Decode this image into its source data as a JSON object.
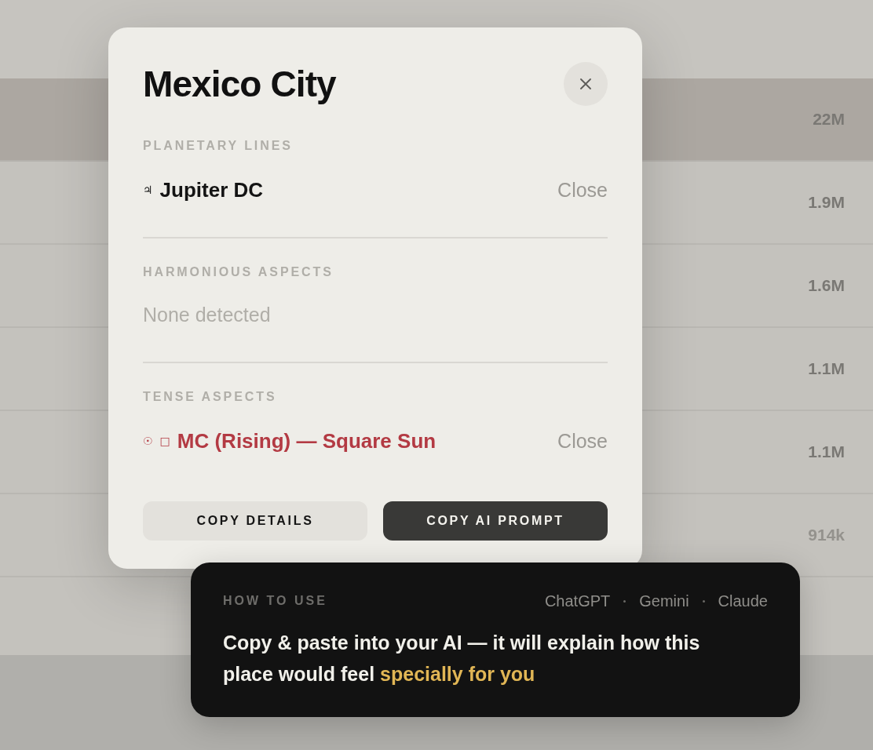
{
  "list": {
    "rows": [
      {
        "value": "22M",
        "selected": true,
        "dimmed": false
      },
      {
        "value": "1.9M",
        "selected": false,
        "dimmed": false
      },
      {
        "value": "1.6M",
        "selected": false,
        "dimmed": false
      },
      {
        "value": "1.1M",
        "selected": false,
        "dimmed": false
      },
      {
        "value": "1.1M",
        "selected": false,
        "dimmed": false
      },
      {
        "value": "914k",
        "selected": false,
        "dimmed": true
      }
    ]
  },
  "modal": {
    "title": "Mexico City",
    "sections": [
      {
        "title": "PLANETARY LINES",
        "kind": "neutral",
        "items": [
          {
            "symbols": [
              "♃"
            ],
            "label": "Jupiter DC",
            "proximity": "Close"
          }
        ]
      },
      {
        "title": "HARMONIOUS ASPECTS",
        "empty_text": "None detected"
      },
      {
        "title": "TENSE ASPECTS",
        "kind": "tense",
        "items": [
          {
            "symbols": [
              "☉",
              "□"
            ],
            "label": "MC (Rising) — Square Sun",
            "proximity": "Close"
          }
        ]
      }
    ],
    "buttons": [
      {
        "label": "COPY DETAILS",
        "kind": "secondary"
      },
      {
        "label": "COPY AI PROMPT",
        "kind": "primary"
      }
    ]
  },
  "tooltip": {
    "title": "HOW TO USE",
    "providers": [
      "ChatGPT",
      "Gemini",
      "Claude"
    ],
    "message": "Copy & paste into your AI — it will explain how this place would feel",
    "highlight": "specially for you"
  }
}
